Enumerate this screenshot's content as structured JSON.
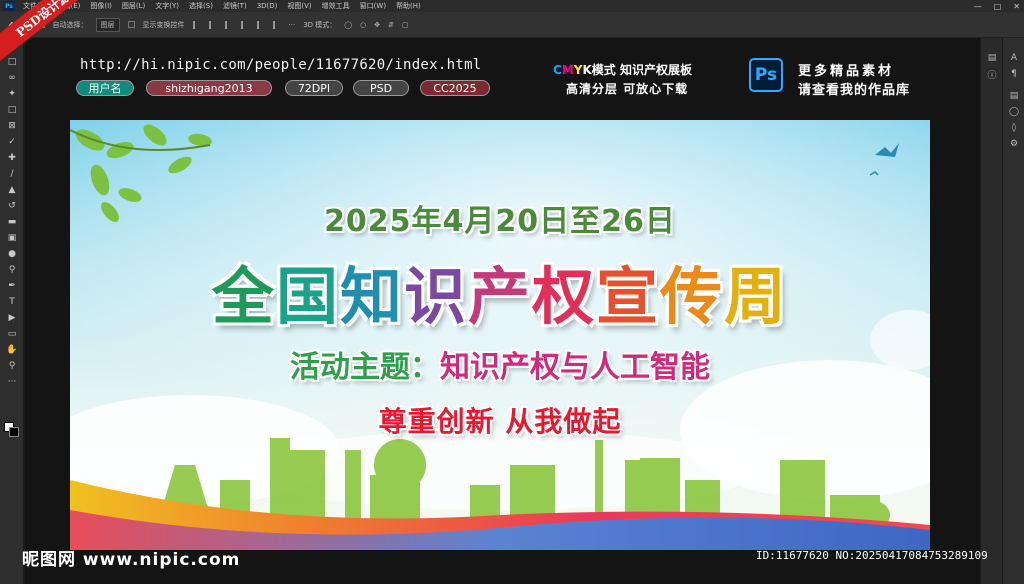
{
  "menubar": {
    "app_icon": "Ps",
    "items": [
      "文件(F)",
      "编辑(E)",
      "图像(I)",
      "图层(L)",
      "文字(Y)",
      "选择(S)",
      "滤镜(T)",
      "3D(D)",
      "视图(V)",
      "增效工具",
      "窗口(W)",
      "帮助(H)"
    ]
  },
  "optbar": {
    "auto_select_label": "自动选择：",
    "target_value": "图层",
    "transform_label": "显示变换控件",
    "mode_label": "3D 模式："
  },
  "ribbon": {
    "text": "PSD设计源文件"
  },
  "info": {
    "url": "http://hi.nipic.com/people/11677620/index.html",
    "pills": [
      "用户名",
      "shizhigang2013",
      "72DPI",
      "PSD",
      "CC2025"
    ]
  },
  "cmyk": {
    "c": "C",
    "m": "M",
    "y": "Y",
    "k": "K",
    "rest": "模式 知识产权展板",
    "line2": "高清分层 可放心下载"
  },
  "ps_logo": "Ps",
  "promo": {
    "line1": "更多精品素材",
    "line2": "请查看我的作品库"
  },
  "poster": {
    "date": "2025年4月20日至26日",
    "title_chars": [
      "全",
      "国",
      "知",
      "识",
      "产",
      "权",
      "宣",
      "传",
      "周"
    ],
    "theme_prefix": "活动主题：",
    "theme_body": "知识产权与人工智能",
    "slogan": "尊重创新 从我做起"
  },
  "footer": {
    "logo": "昵图网 www.nipic.com",
    "id": "ID:11677620 NO:20250417084753289109"
  },
  "colors": {
    "title_gradient": [
      "#1e9a5a",
      "#1aa38a",
      "#1f8fb0",
      "#7b4aa0",
      "#c23a7a",
      "#e0305a",
      "#e6502e",
      "#e98a1a",
      "#e3b010"
    ],
    "theme_prefix": "#2ea04a",
    "theme_body": "#d12a7a",
    "slogan": "#e8182e"
  }
}
